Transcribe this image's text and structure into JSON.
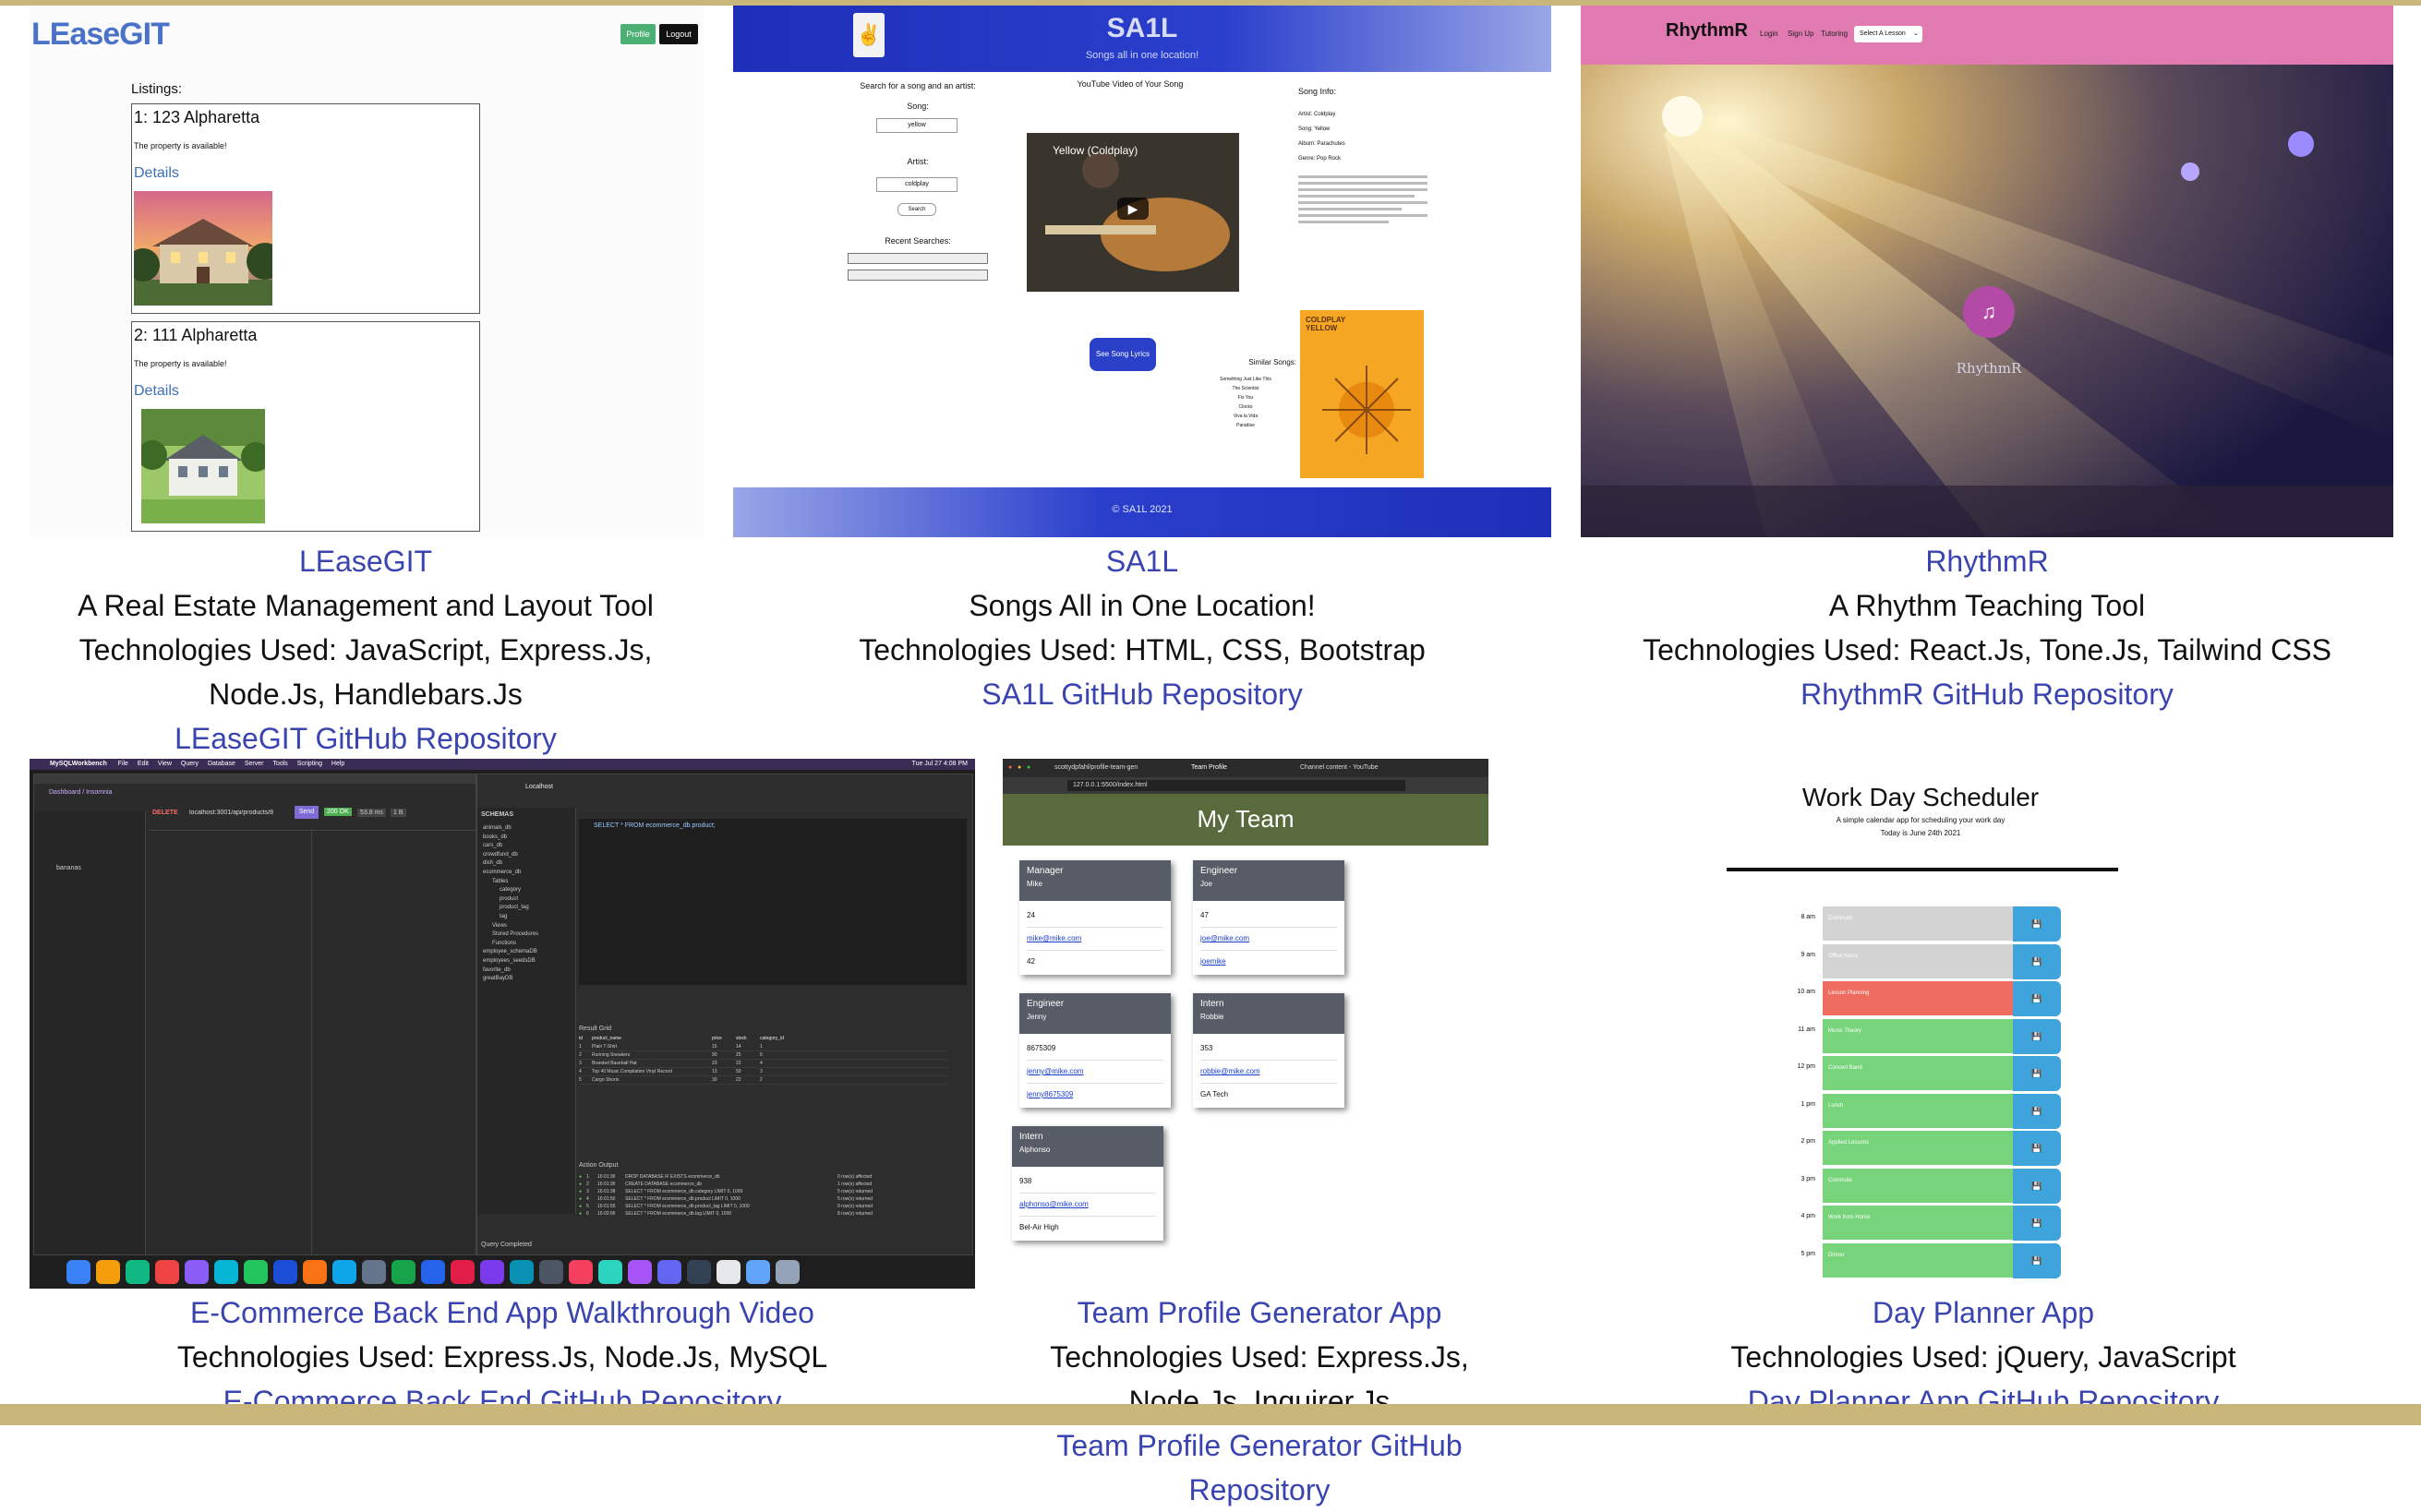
{
  "projects": [
    {
      "title": "LEaseGIT",
      "lines": [
        "A Real Estate Management and Layout Tool",
        "Technologies Used: JavaScript, Express.Js,",
        "Node.Js, Handlebars.Js"
      ],
      "repo": "LEaseGIT GitHub Repository",
      "shot": {
        "logo": "LEaseGIT",
        "btn_profile": "Profile",
        "btn_logout": "Logout",
        "listings_label": "Listings:",
        "listings": [
          {
            "heading": "1: 123 Alpharetta",
            "status": "The property is available!",
            "link": "Details"
          },
          {
            "heading": "2: 111 Alpharetta",
            "status": "The property is available!",
            "link": "Details"
          }
        ]
      }
    },
    {
      "title": "SA1L",
      "lines": [
        "Songs All in One Location!",
        "Technologies Used: HTML, CSS, Bootstrap"
      ],
      "repo": "SA1L GitHub Repository",
      "shot": {
        "logo": "SA1L",
        "tagline": "Songs all in one location!",
        "search_heading": "Search for a song and an artist:",
        "song_label": "Song:",
        "song_value": "yellow",
        "artist_label": "Artist:",
        "artist_value": "coldplay",
        "search_btn": "Search",
        "recent_label": "Recent Searches:",
        "video_heading": "YouTube Video of Your Song",
        "video_title": "Yellow (Coldplay)",
        "lyrics_btn": "See Song Lyrics",
        "info_heading": "Song Info:",
        "info_items": [
          "Artist: Coldplay",
          "Song: Yellow",
          "Album: Parachutes",
          "Genre: Pop Rock"
        ],
        "similar_heading": "Similar Songs:",
        "similar_items": [
          "Something Just Like This",
          "The Scientist",
          "Fix You",
          "Clocks",
          "Viva la Vida",
          "Paradise"
        ],
        "album_text": "COLDPLAY YELLOW",
        "footer": "© SA1L 2021"
      }
    },
    {
      "title": "RhythmR",
      "lines": [
        "A Rhythm Teaching Tool",
        "Technologies Used: React.Js, Tone.Js, Tailwind CSS"
      ],
      "repo": "RhythmR GitHub Repository",
      "shot": {
        "logo": "RhythmR",
        "nav": [
          "Login",
          "Sign Up",
          "Tutoring"
        ],
        "select": "Select A Lesson",
        "brand_mark": "RhythmR"
      }
    },
    {
      "title": "E-Commerce Back End App Walkthrough Video",
      "lines": [
        "Technologies Used: Express.Js, Node.Js, MySQL"
      ],
      "repo": "E-Commerce Back End GitHub Repository",
      "shot": {
        "app": "MySQLWorkbench",
        "menu": [
          "File",
          "Edit",
          "View",
          "Query",
          "Database",
          "Server",
          "Tools",
          "Scripting",
          "Help"
        ],
        "clock": "Tue Jul 27 4:08 PM",
        "dashboard": "Dashboard / Insomnia",
        "method": "DELETE",
        "url": "localhost:3001/api/products/8",
        "send": "Send",
        "status": "200 OK",
        "time": "53.8 ms",
        "size": "1 B",
        "request_name": "bananas",
        "tab_localhost": "Localhost",
        "schemas_label": "SCHEMAS",
        "schemas": [
          "animals_db",
          "books_db",
          "cars_db",
          "crowdfund_db",
          "dish_db",
          "ecommerce_db",
          "Tables",
          "category",
          "product",
          "product_tag",
          "tag",
          "Views",
          "Stored Procedures",
          "Functions",
          "employee_schemaDB",
          "employees_seedsDB",
          "favorite_db",
          "greatBayDB"
        ],
        "query": "SELECT * FROM ecommerce_db.product;",
        "columns": [
          "id",
          "product_name",
          "price",
          "stock",
          "category_id"
        ],
        "rows": [
          [
            "1",
            "Plain T-Shirt",
            "15",
            "14",
            "1"
          ],
          [
            "2",
            "Running Sneakers",
            "90",
            "25",
            "5"
          ],
          [
            "3",
            "Branded Baseball Hat",
            "23",
            "22",
            "4"
          ],
          [
            "4",
            "Top 40 Music Compilation Vinyl Record",
            "13",
            "50",
            "3"
          ],
          [
            "5",
            "Cargo Shorts",
            "30",
            "22",
            "2"
          ]
        ],
        "result_label": "Result Grid",
        "action_label": "Action Output",
        "output_rows": [
          [
            "1",
            "16:01:36",
            "DROP DATABASE IF EXISTS ecommerce_db",
            "0 row(s) affected"
          ],
          [
            "2",
            "16:01:36",
            "CREATE DATABASE ecommerce_db",
            "1 row(s) affected"
          ],
          [
            "3",
            "16:01:38",
            "SELECT * FROM ecommerce_db.category LIMIT 0, 1000",
            "5 row(s) returned"
          ],
          [
            "4",
            "16:01:50",
            "SELECT * FROM ecommerce_db.product LIMIT 0, 1000",
            "5 row(s) returned"
          ],
          [
            "5",
            "16:01:55",
            "SELECT * FROM ecommerce_db.product_tag LIMIT 0, 1000",
            "9 row(s) returned"
          ],
          [
            "6",
            "16:02:06",
            "SELECT * FROM ecommerce_db.tag LIMIT 0, 1000",
            "8 row(s) returned"
          ]
        ],
        "query_done": "Query Completed"
      }
    },
    {
      "title": "Team Profile Generator App",
      "lines": [
        "Technologies Used: Express.Js, Node.Js, Inquirer.Js"
      ],
      "repo": "Team Profile Generator GitHub Repository",
      "shot": {
        "tab1": "scottydpfahl/profile-team-gen",
        "tab2": "Team Profile",
        "tab3": "Channel content - YouTube",
        "url": "127.0.0.1:5500/index.html",
        "heading": "My Team",
        "members": [
          {
            "role": "Manager",
            "name": "Mike",
            "id": "24",
            "email": "mike@mike.com",
            "extra": "42",
            "extra_link": false
          },
          {
            "role": "Engineer",
            "name": "Joe",
            "id": "47",
            "email": "joe@mike.com",
            "extra": "joemike",
            "extra_link": true
          },
          {
            "role": "Engineer",
            "name": "Jenny",
            "id": "8675309",
            "email": "jenny@mike.com",
            "extra": "jenny8675309",
            "extra_link": true
          },
          {
            "role": "Intern",
            "name": "Robbie",
            "id": "353",
            "email": "robbie@mike.com",
            "extra": "GA Tech",
            "extra_link": false
          },
          {
            "role": "Intern",
            "name": "Alphonso",
            "id": "938",
            "email": "alphonso@mike.com",
            "extra": "Bel-Air High",
            "extra_link": false
          }
        ]
      }
    },
    {
      "title": "Day Planner App",
      "lines": [
        "Technologies Used: jQuery, JavaScript"
      ],
      "repo": "Day Planner App GitHub Repository",
      "shot": {
        "heading": "Work Day Scheduler",
        "sub1": "A simple calendar app for scheduling your work day",
        "sub2": "Today is June 24th 2021",
        "hours": [
          {
            "time": "8 am",
            "task": "Commute",
            "state": "past"
          },
          {
            "time": "9 am",
            "task": "Office hours",
            "state": "past"
          },
          {
            "time": "10 am",
            "task": "Lesson Planning",
            "state": "present"
          },
          {
            "time": "11 am",
            "task": "Music Theory",
            "state": "future"
          },
          {
            "time": "12 pm",
            "task": "Concert Band",
            "state": "future"
          },
          {
            "time": "1 pm",
            "task": "Lunch",
            "state": "future"
          },
          {
            "time": "2 pm",
            "task": "Applied Lessons",
            "state": "future"
          },
          {
            "time": "3 pm",
            "task": "Commute",
            "state": "future"
          },
          {
            "time": "4 pm",
            "task": "Work from Home",
            "state": "future"
          },
          {
            "time": "5 pm",
            "task": "Dinner",
            "state": "future"
          }
        ]
      }
    }
  ],
  "colors": {
    "link": "#3a44b0",
    "band": "#c8b67a",
    "rhythmr_nav": "#e07ab0",
    "sail_header": "#2a3fcc",
    "planner_past": "#d3d3d3",
    "planner_present": "#ee6c60",
    "planner_future": "#77d47a",
    "planner_save": "#3fa3dc"
  }
}
